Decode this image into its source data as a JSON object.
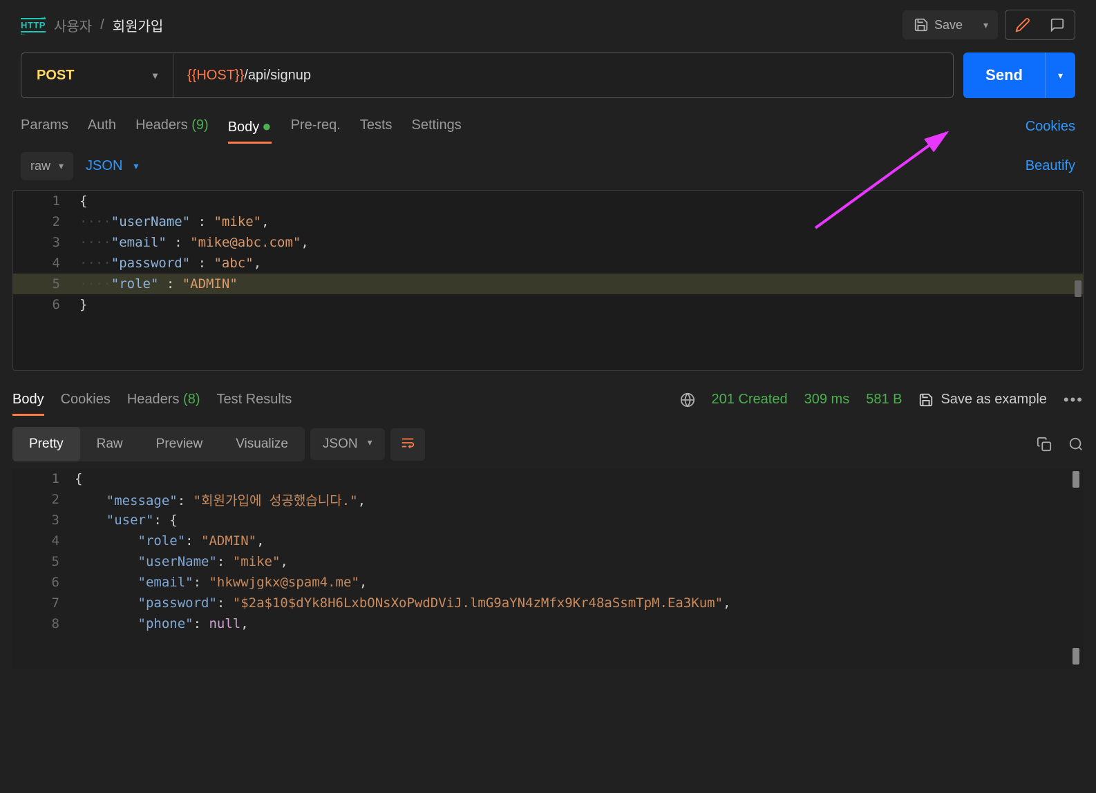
{
  "breadcrumb": {
    "folder": "사용자",
    "name": "회원가입"
  },
  "topActions": {
    "save": "Save"
  },
  "request": {
    "method": "POST",
    "urlVar": "{{HOST}}",
    "urlPath": "/api/signup",
    "send": "Send"
  },
  "reqTabs": {
    "params": "Params",
    "auth": "Auth",
    "headersLabel": "Headers",
    "headersCount": "(9)",
    "body": "Body",
    "prereq": "Pre-req.",
    "tests": "Tests",
    "settings": "Settings",
    "cookies": "Cookies"
  },
  "bodyControls": {
    "raw": "raw",
    "type": "JSON",
    "beautify": "Beautify"
  },
  "reqBody": {
    "lines": [
      "1",
      "2",
      "3",
      "4",
      "5",
      "6"
    ],
    "k_userName": "\"userName\"",
    "v_userName": "\"mike\"",
    "k_email": "\"email\"",
    "v_email": "\"mike@abc.com\"",
    "k_password": "\"password\"",
    "v_password": "\"abc\"",
    "k_role": "\"role\"",
    "v_role": "\"ADMIN\""
  },
  "respTabs": {
    "body": "Body",
    "cookies": "Cookies",
    "headersLabel": "Headers",
    "headersCount": "(8)",
    "testResults": "Test Results"
  },
  "respMeta": {
    "status": "201 Created",
    "time": "309 ms",
    "size": "581 B",
    "saveExample": "Save as example"
  },
  "viewer": {
    "pretty": "Pretty",
    "raw": "Raw",
    "preview": "Preview",
    "visualize": "Visualize",
    "format": "JSON"
  },
  "respBody": {
    "lines": [
      "1",
      "2",
      "3",
      "4",
      "5",
      "6",
      "7",
      "8"
    ],
    "k_message": "\"message\"",
    "v_message": "\"회원가입에 성공했습니다.\"",
    "k_user": "\"user\"",
    "k_role": "\"role\"",
    "v_role": "\"ADMIN\"",
    "k_userName": "\"userName\"",
    "v_userName": "\"mike\"",
    "k_email": "\"email\"",
    "v_email": "\"hkwwjgkx@spam4.me\"",
    "k_password": "\"password\"",
    "v_password": "\"$2a$10$dYk8H6LxbONsXoPwdDViJ.lmG9aYN4zMfx9Kr48aSsmTpM.Ea3Kum\"",
    "k_phone": "\"phone\"",
    "v_phone": "null"
  }
}
